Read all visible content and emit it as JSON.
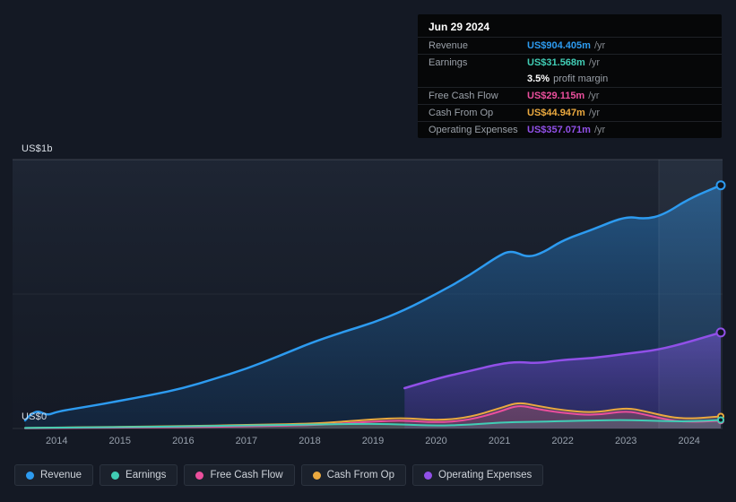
{
  "tooltip": {
    "date": "Jun 29 2024",
    "rows": [
      {
        "label": "Revenue",
        "value": "US$904.405m",
        "suffix": "/yr"
      },
      {
        "label": "Earnings",
        "value": "US$31.568m",
        "suffix": "/yr"
      },
      {
        "label": "Free Cash Flow",
        "value": "US$29.115m",
        "suffix": "/yr"
      },
      {
        "label": "Cash From Op",
        "value": "US$44.947m",
        "suffix": "/yr"
      },
      {
        "label": "Operating Expenses",
        "value": "US$357.071m",
        "suffix": "/yr"
      }
    ],
    "profit_margin": {
      "value": "3.5%",
      "label": "profit margin"
    }
  },
  "chart_data": {
    "type": "area",
    "units": "US$m",
    "x_domain": [
      2013.5,
      2024.5
    ],
    "y_domain": [
      0,
      1000
    ],
    "x_ticks": [
      2014,
      2015,
      2016,
      2017,
      2018,
      2019,
      2020,
      2021,
      2022,
      2023,
      2024
    ],
    "y_axis": {
      "max_label": "US$1b",
      "min_label": "US$0"
    },
    "highlight_from_x": 2023.52,
    "grid": "horizontal",
    "legend_position": "bottom",
    "series": [
      {
        "id": "revenue",
        "name": "Revenue",
        "color": "#2d9bf0",
        "points": [
          [
            2013.5,
            30
          ],
          [
            2013.65,
            72
          ],
          [
            2013.85,
            48
          ],
          [
            2014,
            63
          ],
          [
            2014.5,
            82
          ],
          [
            2015,
            103
          ],
          [
            2015.5,
            125
          ],
          [
            2016,
            150
          ],
          [
            2016.5,
            185
          ],
          [
            2017,
            222
          ],
          [
            2017.5,
            268
          ],
          [
            2018,
            317
          ],
          [
            2018.5,
            357
          ],
          [
            2019,
            393
          ],
          [
            2019.5,
            440
          ],
          [
            2020,
            500
          ],
          [
            2020.5,
            565
          ],
          [
            2021,
            645
          ],
          [
            2021.2,
            662
          ],
          [
            2021.45,
            635
          ],
          [
            2021.7,
            655
          ],
          [
            2022,
            700
          ],
          [
            2022.5,
            742
          ],
          [
            2023,
            790
          ],
          [
            2023.3,
            778
          ],
          [
            2023.6,
            795
          ],
          [
            2024,
            855
          ],
          [
            2024.5,
            904.405
          ]
        ]
      },
      {
        "id": "earnings",
        "name": "Earnings",
        "color": "#41cdb5",
        "points": [
          [
            2013.5,
            2
          ],
          [
            2014,
            3
          ],
          [
            2015,
            5
          ],
          [
            2016,
            8
          ],
          [
            2017,
            11
          ],
          [
            2018,
            15
          ],
          [
            2019,
            18
          ],
          [
            2019.5,
            15
          ],
          [
            2020,
            10
          ],
          [
            2020.5,
            14
          ],
          [
            2021,
            22
          ],
          [
            2021.5,
            25
          ],
          [
            2022,
            27
          ],
          [
            2022.5,
            30
          ],
          [
            2023,
            32
          ],
          [
            2023.5,
            28
          ],
          [
            2024,
            26
          ],
          [
            2024.5,
            31.568
          ]
        ]
      },
      {
        "id": "free-cash-flow",
        "name": "Free Cash Flow",
        "color": "#eb4f9d",
        "points": [
          [
            2013.5,
            1
          ],
          [
            2014,
            2
          ],
          [
            2015,
            3
          ],
          [
            2016,
            5
          ],
          [
            2017,
            8
          ],
          [
            2018,
            12
          ],
          [
            2018.5,
            18
          ],
          [
            2019,
            26
          ],
          [
            2019.5,
            30
          ],
          [
            2020,
            22
          ],
          [
            2020.5,
            30
          ],
          [
            2021,
            62
          ],
          [
            2021.3,
            88
          ],
          [
            2021.6,
            72
          ],
          [
            2022,
            58
          ],
          [
            2022.5,
            48
          ],
          [
            2023,
            66
          ],
          [
            2023.3,
            52
          ],
          [
            2023.7,
            30
          ],
          [
            2024,
            24
          ],
          [
            2024.5,
            29.115
          ]
        ]
      },
      {
        "id": "cash-from-op",
        "name": "Cash From Op",
        "color": "#eba93f",
        "points": [
          [
            2013.5,
            2
          ],
          [
            2014,
            4
          ],
          [
            2015,
            6
          ],
          [
            2016,
            9
          ],
          [
            2017,
            13
          ],
          [
            2018,
            18
          ],
          [
            2018.5,
            25
          ],
          [
            2019,
            34
          ],
          [
            2019.5,
            40
          ],
          [
            2020,
            30
          ],
          [
            2020.5,
            40
          ],
          [
            2021,
            75
          ],
          [
            2021.3,
            98
          ],
          [
            2021.6,
            84
          ],
          [
            2022,
            68
          ],
          [
            2022.5,
            58
          ],
          [
            2023,
            78
          ],
          [
            2023.3,
            64
          ],
          [
            2023.7,
            42
          ],
          [
            2024,
            36
          ],
          [
            2024.5,
            44.947
          ]
        ]
      },
      {
        "id": "operating-expenses",
        "name": "Operating Expenses",
        "color": "#9150e8",
        "points": [
          [
            2019.5,
            150
          ],
          [
            2020,
            185
          ],
          [
            2020.5,
            212
          ],
          [
            2021,
            240
          ],
          [
            2021.3,
            248
          ],
          [
            2021.6,
            242
          ],
          [
            2022,
            255
          ],
          [
            2022.5,
            262
          ],
          [
            2023,
            278
          ],
          [
            2023.5,
            292
          ],
          [
            2024,
            322
          ],
          [
            2024.5,
            357.071
          ]
        ]
      }
    ]
  }
}
